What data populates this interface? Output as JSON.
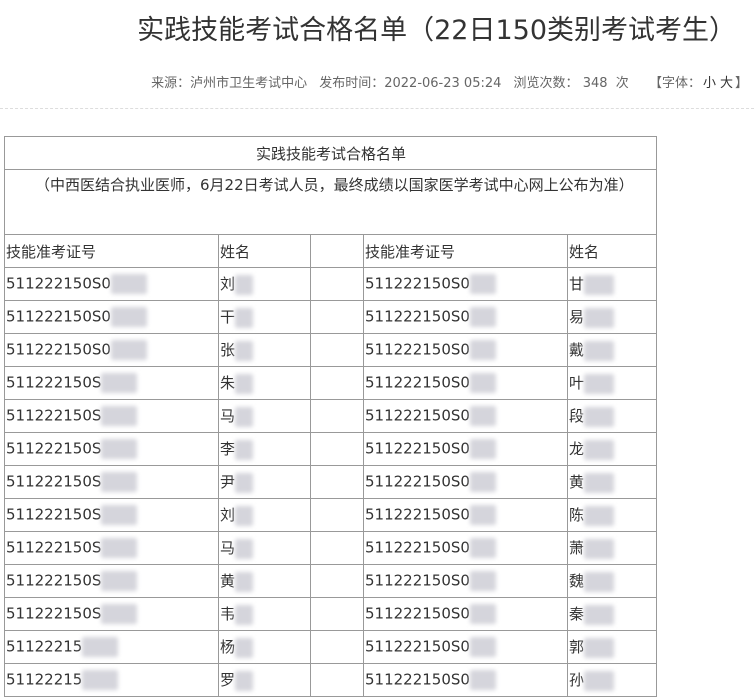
{
  "page": {
    "title": "实践技能考试合格名单（22日150类别考试考生）",
    "meta": {
      "source": "来源：泸州市卫生考试中心",
      "published": "发布时间：2022-06-23 05:24",
      "views_label": "浏览次数：",
      "views_count": "348",
      "views_unit": "次",
      "font_label": "【字体：",
      "font_small": "小",
      "font_large": "大",
      "font_close": "】"
    }
  },
  "table": {
    "caption": "实践技能考试合格名单",
    "note": "（中西医结合执业医师，6月22日考试人员，最终成绩以国家医学考试中心网上公布为准）",
    "headers": [
      "技能准考证号",
      "姓名",
      "",
      "技能准考证号",
      "姓名"
    ],
    "rows": [
      {
        "id1": "511222150S0",
        "name1": "刘",
        "id2": "511222150S0",
        "name2": "甘"
      },
      {
        "id1": "511222150S0",
        "name1": "干",
        "id2": "511222150S0",
        "name2": "易"
      },
      {
        "id1": "511222150S0",
        "name1": "张",
        "id2": "511222150S0",
        "name2": "戴"
      },
      {
        "id1": "511222150S",
        "name1": "朱",
        "id2": "511222150S0",
        "name2": "叶"
      },
      {
        "id1": "511222150S",
        "name1": "马",
        "id2": "511222150S0",
        "name2": "段"
      },
      {
        "id1": "511222150S",
        "name1": "李",
        "id2": "511222150S0",
        "name2": "龙"
      },
      {
        "id1": "511222150S",
        "name1": "尹",
        "id2": "511222150S0",
        "name2": "黄"
      },
      {
        "id1": "511222150S",
        "name1": "刘",
        "id2": "511222150S0",
        "name2": "陈"
      },
      {
        "id1": "511222150S",
        "name1": "马",
        "id2": "511222150S0",
        "name2": "萧"
      },
      {
        "id1": "511222150S",
        "name1": "黄",
        "id2": "511222150S0",
        "name2": "魏"
      },
      {
        "id1": "511222150S",
        "name1": "韦",
        "id2": "511222150S0",
        "name2": "秦"
      },
      {
        "id1": "51122215",
        "name1": "杨",
        "id2": "511222150S0",
        "name2": "郭"
      },
      {
        "id1": "51122215",
        "name1": "罗",
        "id2": "511222150S0",
        "name2": "孙"
      }
    ]
  }
}
